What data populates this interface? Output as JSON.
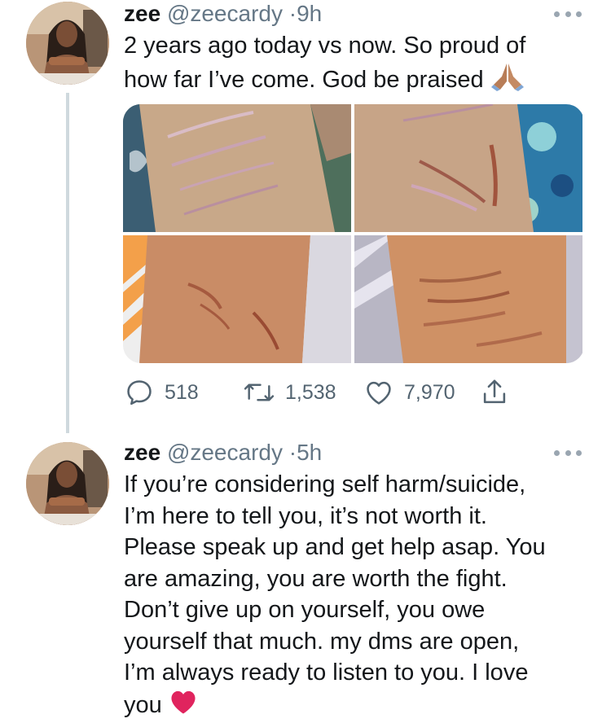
{
  "tweets": [
    {
      "name": "zee",
      "handle": "@zeecardy",
      "dot": "·",
      "time": "9h",
      "text_lines": [
        "2 years ago today vs now. So proud of",
        "how far I’ve come. God be praised"
      ],
      "emoji": "praying-hands",
      "actions": {
        "reply_count": "518",
        "retweet_count": "1,538",
        "like_count": "7,970"
      }
    },
    {
      "name": "zee",
      "handle": "@zeecardy",
      "dot": "·",
      "time": "5h",
      "text_lines": [
        "If you’re considering self harm/suicide,",
        "I’m here to tell you, it’s not worth it.",
        "Please speak up and get help asap. You",
        "are amazing, you are worth the fight.",
        "Don’t give up on yourself, you owe",
        "yourself that much.  my dms are open,",
        "I’m always ready to listen to you. I love",
        "you"
      ],
      "emoji": "red-heart"
    }
  ],
  "colors": {
    "text": "#14171a",
    "secondary": "#657786",
    "thread_line": "#cfd9de",
    "heart": "#e0245e"
  }
}
